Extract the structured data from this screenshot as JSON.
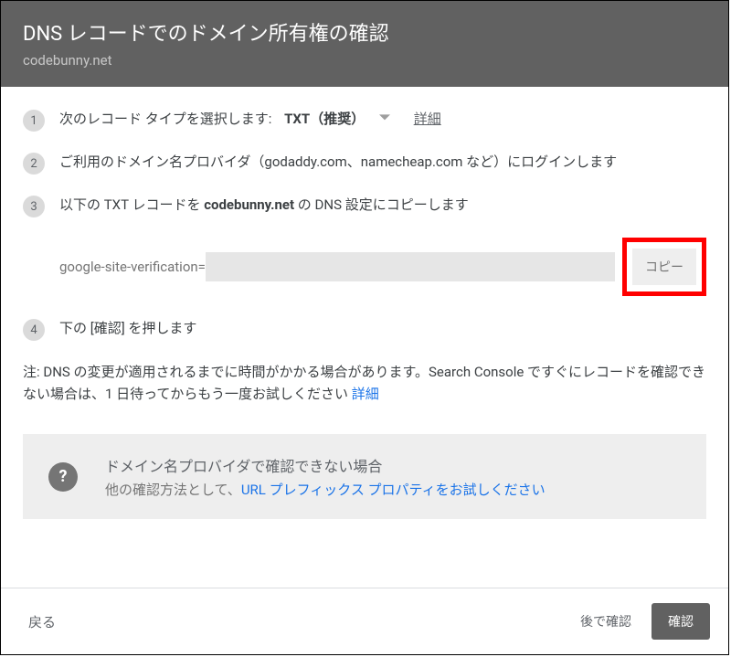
{
  "header": {
    "title": "DNS レコードでのドメイン所有権の確認",
    "subtitle": "codebunny.net"
  },
  "steps": [
    {
      "num": "1",
      "prefix": "次のレコード タイプを選択します:",
      "dropdown": "TXT（推奨）",
      "detail": "詳細"
    },
    {
      "num": "2",
      "text": "ご利用のドメイン名プロバイダ（godaddy.com、namecheap.com など）にログインします"
    },
    {
      "num": "3",
      "pre": "以下の TXT レコードを ",
      "bold": "codebunny.net",
      "post": " の DNS 設定にコピーします"
    },
    {
      "num": "4",
      "text": "下の [確認] を押します"
    }
  ],
  "txtrecord": {
    "label": "google-site-verification=",
    "value": "",
    "copy": "コピー"
  },
  "note": {
    "text": "注: DNS の変更が適用されるまでに時間がかかる場合があります。Search Console ですぐにレコードを確認できない場合は、1 日待ってからもう一度お試しください ",
    "link": "詳細"
  },
  "info": {
    "title": "ドメイン名プロバイダで確認できない場合",
    "pre": "他の確認方法として、",
    "link": "URL プレフィックス プロパティをお試しください"
  },
  "footer": {
    "back": "戻る",
    "later": "後で確認",
    "confirm": "確認"
  }
}
